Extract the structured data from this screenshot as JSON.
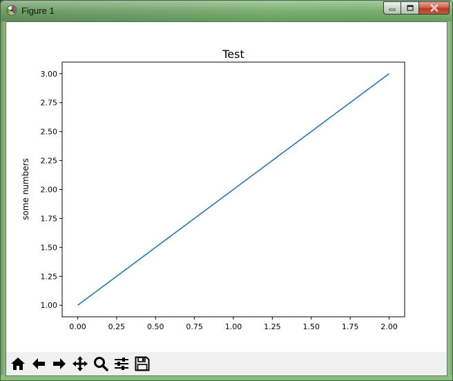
{
  "window": {
    "title": "Figure 1"
  },
  "chart_data": {
    "type": "line",
    "title": "Test",
    "xlabel": "",
    "ylabel": "some numbers",
    "x": [
      0,
      1,
      2
    ],
    "series": [
      {
        "values": [
          1,
          2,
          3
        ],
        "color": "#1f77b4"
      }
    ],
    "xlim": [
      -0.1,
      2.1
    ],
    "ylim": [
      0.9,
      3.1
    ],
    "xticks": [
      0.0,
      0.25,
      0.5,
      0.75,
      1.0,
      1.25,
      1.5,
      1.75,
      2.0
    ],
    "xtick_labels": [
      "0.00",
      "0.25",
      "0.50",
      "0.75",
      "1.00",
      "1.25",
      "1.50",
      "1.75",
      "2.00"
    ],
    "yticks": [
      1.0,
      1.25,
      1.5,
      1.75,
      2.0,
      2.25,
      2.5,
      2.75,
      3.0
    ],
    "ytick_labels": [
      "1.00",
      "1.25",
      "1.50",
      "1.75",
      "2.00",
      "2.25",
      "2.50",
      "2.75",
      "3.00"
    ],
    "grid": false
  },
  "toolbar": {
    "buttons": [
      {
        "icon": "home-icon"
      },
      {
        "icon": "back-arrow-icon"
      },
      {
        "icon": "forward-arrow-icon"
      },
      {
        "icon": "pan-move-icon"
      },
      {
        "icon": "zoom-magnifier-icon"
      },
      {
        "icon": "subplots-config-icon"
      },
      {
        "icon": "save-floppy-icon"
      }
    ]
  }
}
